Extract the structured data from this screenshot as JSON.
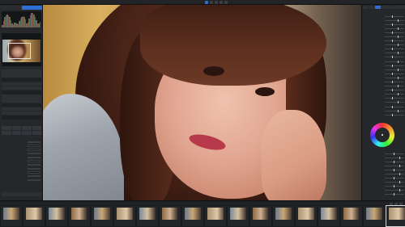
{
  "window": {
    "title": ""
  },
  "top_bar": {
    "tabs": [
      "",
      "",
      ""
    ],
    "right_label": ""
  },
  "left_panel": {
    "tabs": [
      "",
      "",
      ""
    ],
    "rows": [
      "",
      "",
      "",
      "",
      "",
      "",
      "",
      "",
      "",
      "",
      "",
      ""
    ]
  },
  "filmstrip": {
    "selected_index": 17,
    "count": 18
  },
  "colors": {
    "accent": "#2d6fd6",
    "panel": "#26272a",
    "background": "#1b1c1e"
  },
  "icons": [
    "grid-icon",
    "compare-icon",
    "crop-icon",
    "brush-icon",
    "settings-icon"
  ]
}
